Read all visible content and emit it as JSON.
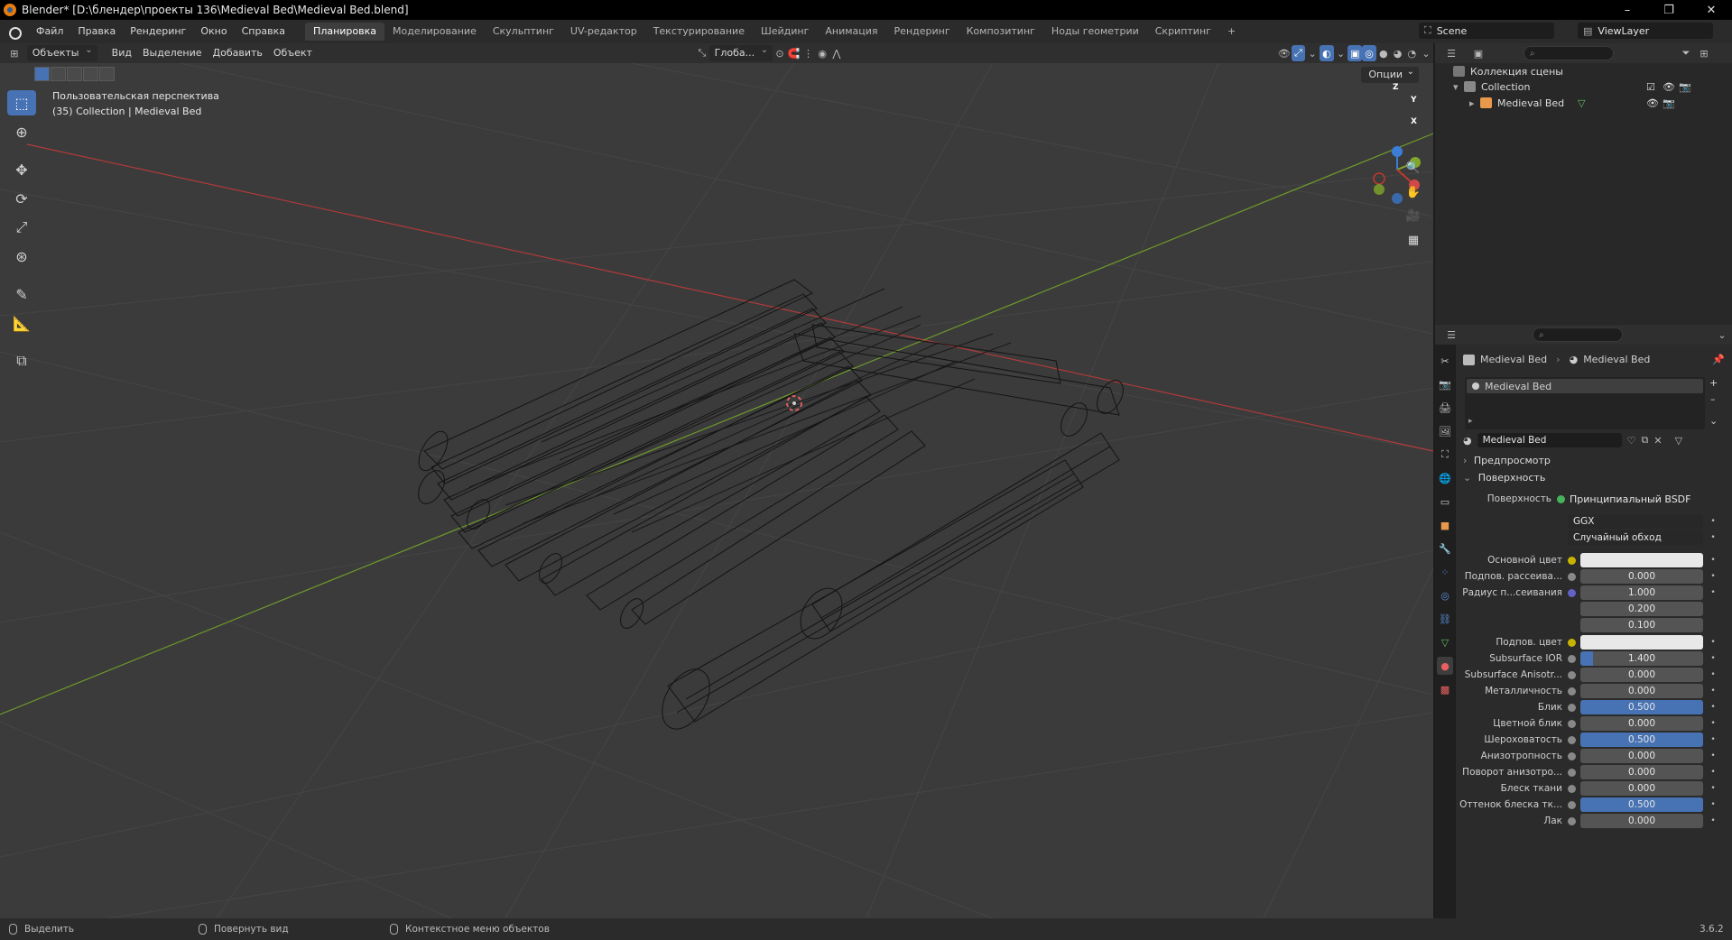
{
  "window": {
    "title": "Blender* [D:\\блендер\\проекты 136\\Medieval Bed\\Medieval Bed.blend]",
    "controls": [
      "–",
      "❐",
      "✕"
    ]
  },
  "menu": {
    "items": [
      "Файл",
      "Правка",
      "Рендеринг",
      "Окно",
      "Справка"
    ]
  },
  "workspaces": {
    "tabs": [
      "Планировка",
      "Моделирование",
      "Скульптинг",
      "UV-редактор",
      "Текстурирование",
      "Шейдинг",
      "Анимация",
      "Рендеринг",
      "Композитинг",
      "Ноды геометрии",
      "Скриптинг"
    ],
    "active": "Планировка",
    "add": "+"
  },
  "scene": {
    "name": "Scene",
    "view_layer": "ViewLayer"
  },
  "viewport_header": {
    "mode": "Объекты",
    "menus": [
      "Вид",
      "Выделение",
      "Добавить",
      "Объект"
    ],
    "orientation": "Глоба...",
    "options": "Опции"
  },
  "viewport": {
    "perspective_label": "Пользовательская перспектива",
    "collection_label": "(35) Collection | Medieval Bed",
    "gizmo": {
      "z": "Z",
      "y": "Y",
      "x": "X"
    }
  },
  "outliner": {
    "scene_collection": "Коллекция сцены",
    "collection": "Collection",
    "object": "Medieval Bed"
  },
  "properties": {
    "breadcrumb_object": "Medieval Bed",
    "breadcrumb_material": "Medieval Bed",
    "slot_name": "Medieval Bed",
    "material_name": "Medieval Bed",
    "sections": {
      "preview": "Предпросмотр",
      "surface": "Поверхность"
    },
    "surface_label": "Поверхность",
    "surface_value": "Принципиальный BSDF",
    "distribution": "GGX",
    "subsurface_method": "Случайный обход",
    "rows": [
      {
        "label": "Основной цвет",
        "value": "",
        "kind": "color",
        "dot": "#c8b400",
        "fill": 0
      },
      {
        "label": "Подпов. рассеива...",
        "value": "0.000",
        "kind": "num",
        "dot": "#888888",
        "fill": 0
      },
      {
        "label": "Радиус п...сеивания",
        "value": "1.000",
        "kind": "num",
        "dot": "#6363c7",
        "fill": 0
      },
      {
        "label": "",
        "value": "0.200",
        "kind": "num",
        "dot": "",
        "fill": 0
      },
      {
        "label": "",
        "value": "0.100",
        "kind": "num",
        "dot": "",
        "fill": 0
      },
      {
        "label": "Подпов. цвет",
        "value": "",
        "kind": "color",
        "dot": "#c8b400",
        "fill": 0
      },
      {
        "label": "Subsurface IOR",
        "value": "1.400",
        "kind": "num",
        "dot": "#888888",
        "fill": 0.1
      },
      {
        "label": "Subsurface Anisotr...",
        "value": "0.000",
        "kind": "num",
        "dot": "#888888",
        "fill": 0
      },
      {
        "label": "Металличность",
        "value": "0.000",
        "kind": "num",
        "dot": "#888888",
        "fill": 0
      },
      {
        "label": "Блик",
        "value": "0.500",
        "kind": "num",
        "dot": "#888888",
        "fill": 1.0
      },
      {
        "label": "Цветной блик",
        "value": "0.000",
        "kind": "num",
        "dot": "#888888",
        "fill": 0
      },
      {
        "label": "Шероховатость",
        "value": "0.500",
        "kind": "num",
        "dot": "#888888",
        "fill": 1.0
      },
      {
        "label": "Анизотропность",
        "value": "0.000",
        "kind": "num",
        "dot": "#888888",
        "fill": 0
      },
      {
        "label": "Поворот анизотро...",
        "value": "0.000",
        "kind": "num",
        "dot": "#888888",
        "fill": 0
      },
      {
        "label": "Блеск ткани",
        "value": "0.000",
        "kind": "num",
        "dot": "#888888",
        "fill": 0
      },
      {
        "label": "Оттенок блеска тк...",
        "value": "0.500",
        "kind": "num",
        "dot": "#888888",
        "fill": 1.0
      },
      {
        "label": "Лак",
        "value": "0.000",
        "kind": "num",
        "dot": "#888888",
        "fill": 0
      }
    ]
  },
  "statusbar": {
    "select": "Выделить",
    "rotate": "Повернуть вид",
    "context": "Контекстное меню объектов",
    "version": "3.6.2"
  },
  "colors": {
    "accent": "#4772b3",
    "x_axis": "#c0392b",
    "y_axis": "#7fa82a",
    "z_axis": "#3b7dd8"
  },
  "icons": {
    "select_tool": "select-box-icon",
    "cursor_tool": "cursor-icon",
    "move_tool": "move-icon",
    "rotate_tool": "rotate-icon",
    "scale_tool": "scale-icon",
    "transform_tool": "transform-icon",
    "annotate_tool": "annotate-icon",
    "measure_tool": "measure-icon",
    "add_cube_tool": "add-cube-icon"
  }
}
